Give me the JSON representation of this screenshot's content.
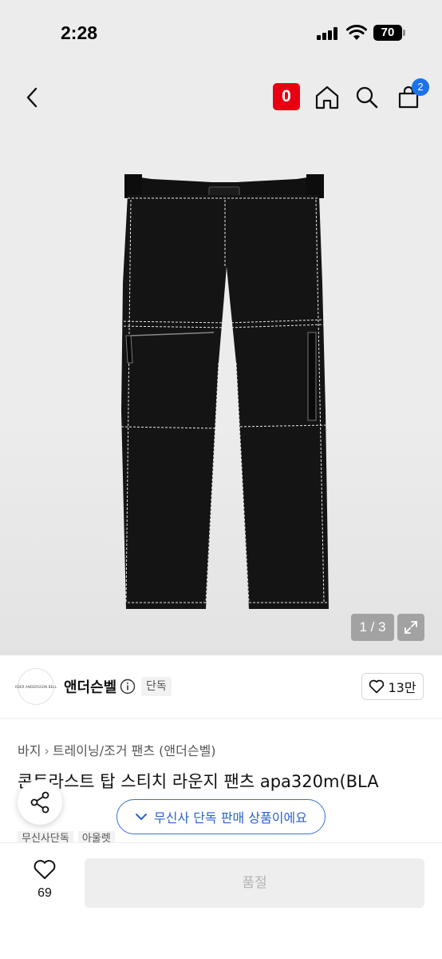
{
  "status_bar": {
    "time": "2:28",
    "battery": "70"
  },
  "header": {
    "badge_label": "0",
    "cart_count": "2"
  },
  "gallery": {
    "counter": "1 / 3"
  },
  "brand": {
    "logo_text": "ADER ANDERSSON BELL",
    "name": "앤더슨벨",
    "exclusive_label": "단독",
    "likes": "13만"
  },
  "product": {
    "breadcrumb": [
      "바지",
      "트레이닝/조거 팬츠 (앤더슨벨)"
    ],
    "title": "콘트라스트 탑 스티치 라운지 팬츠 apa320m(BLA",
    "tags": [
      "무신사단독",
      "아울렛"
    ]
  },
  "toast": {
    "text": "무신사 단독 판매 상품이에요"
  },
  "bottom": {
    "wish_count": "69",
    "buy_label": "품절"
  },
  "colors": {
    "accent_red": "#e60012",
    "accent_blue": "#2c62cf",
    "badge_blue": "#1a73e8"
  }
}
